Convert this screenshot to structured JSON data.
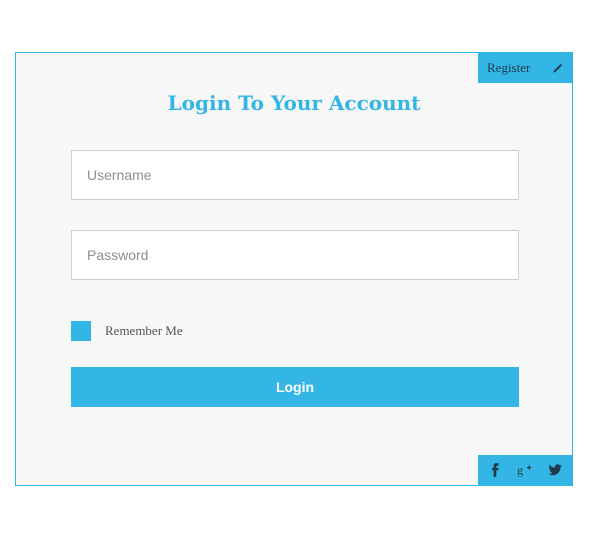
{
  "colors": {
    "accent": "#33b5e5",
    "panel_bg": "#f7f7f7",
    "icon_dark": "#1f3a4a"
  },
  "register": {
    "label": "Register",
    "icon": "pencil-icon"
  },
  "form": {
    "title": "Login To Your Account",
    "username": {
      "placeholder": "Username",
      "value": ""
    },
    "password": {
      "placeholder": "Password",
      "value": ""
    },
    "remember_label": "Remember Me",
    "remember_checked": true,
    "login_label": "Login"
  },
  "social": [
    "facebook-icon",
    "google-plus-icon",
    "twitter-icon"
  ]
}
